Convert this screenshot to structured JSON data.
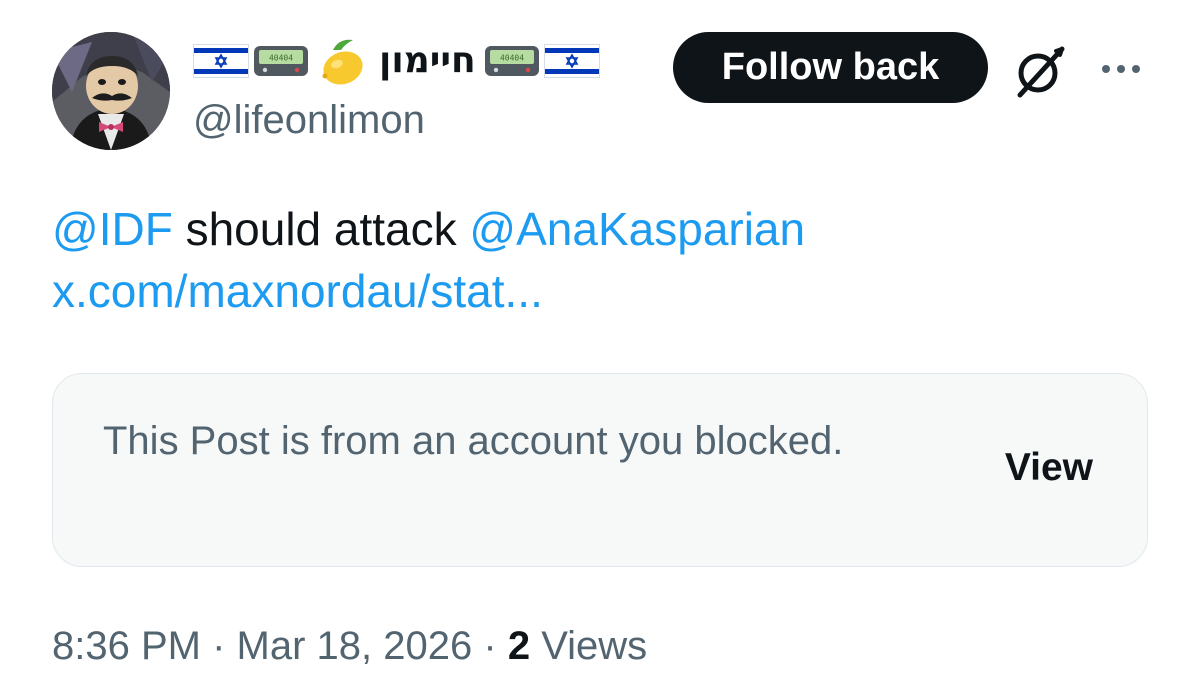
{
  "author": {
    "display_name": "חיימון",
    "handle": "@lifeonlimon",
    "name_emoji": [
      "israel-flag-icon",
      "pager-icon",
      "lemon-icon",
      "pager-icon",
      "israel-flag-icon"
    ],
    "pager_text": "40404"
  },
  "actions": {
    "follow_label": "Follow back",
    "grok_icon": "grok-icon",
    "more_icon": "more-options-icon"
  },
  "tweet": {
    "mention_1": "@IDF",
    "text_middle": " should attack ",
    "mention_2": "@AnaKasparian",
    "link": "x.com/maxnordau/stat..."
  },
  "quote": {
    "message": "This Post is from an account you blocked.",
    "view_label": "View"
  },
  "meta": {
    "time": "8:36 PM",
    "separator": "·",
    "date": "Mar 18, 2026",
    "views_count": "2",
    "views_label": "Views"
  },
  "colors": {
    "link": "#1d9bf0",
    "text": "#0f1419",
    "secondary": "#536471",
    "button_bg": "#0f1419",
    "card_bg": "#f7f9f9",
    "flag_blue": "#0038b8"
  }
}
